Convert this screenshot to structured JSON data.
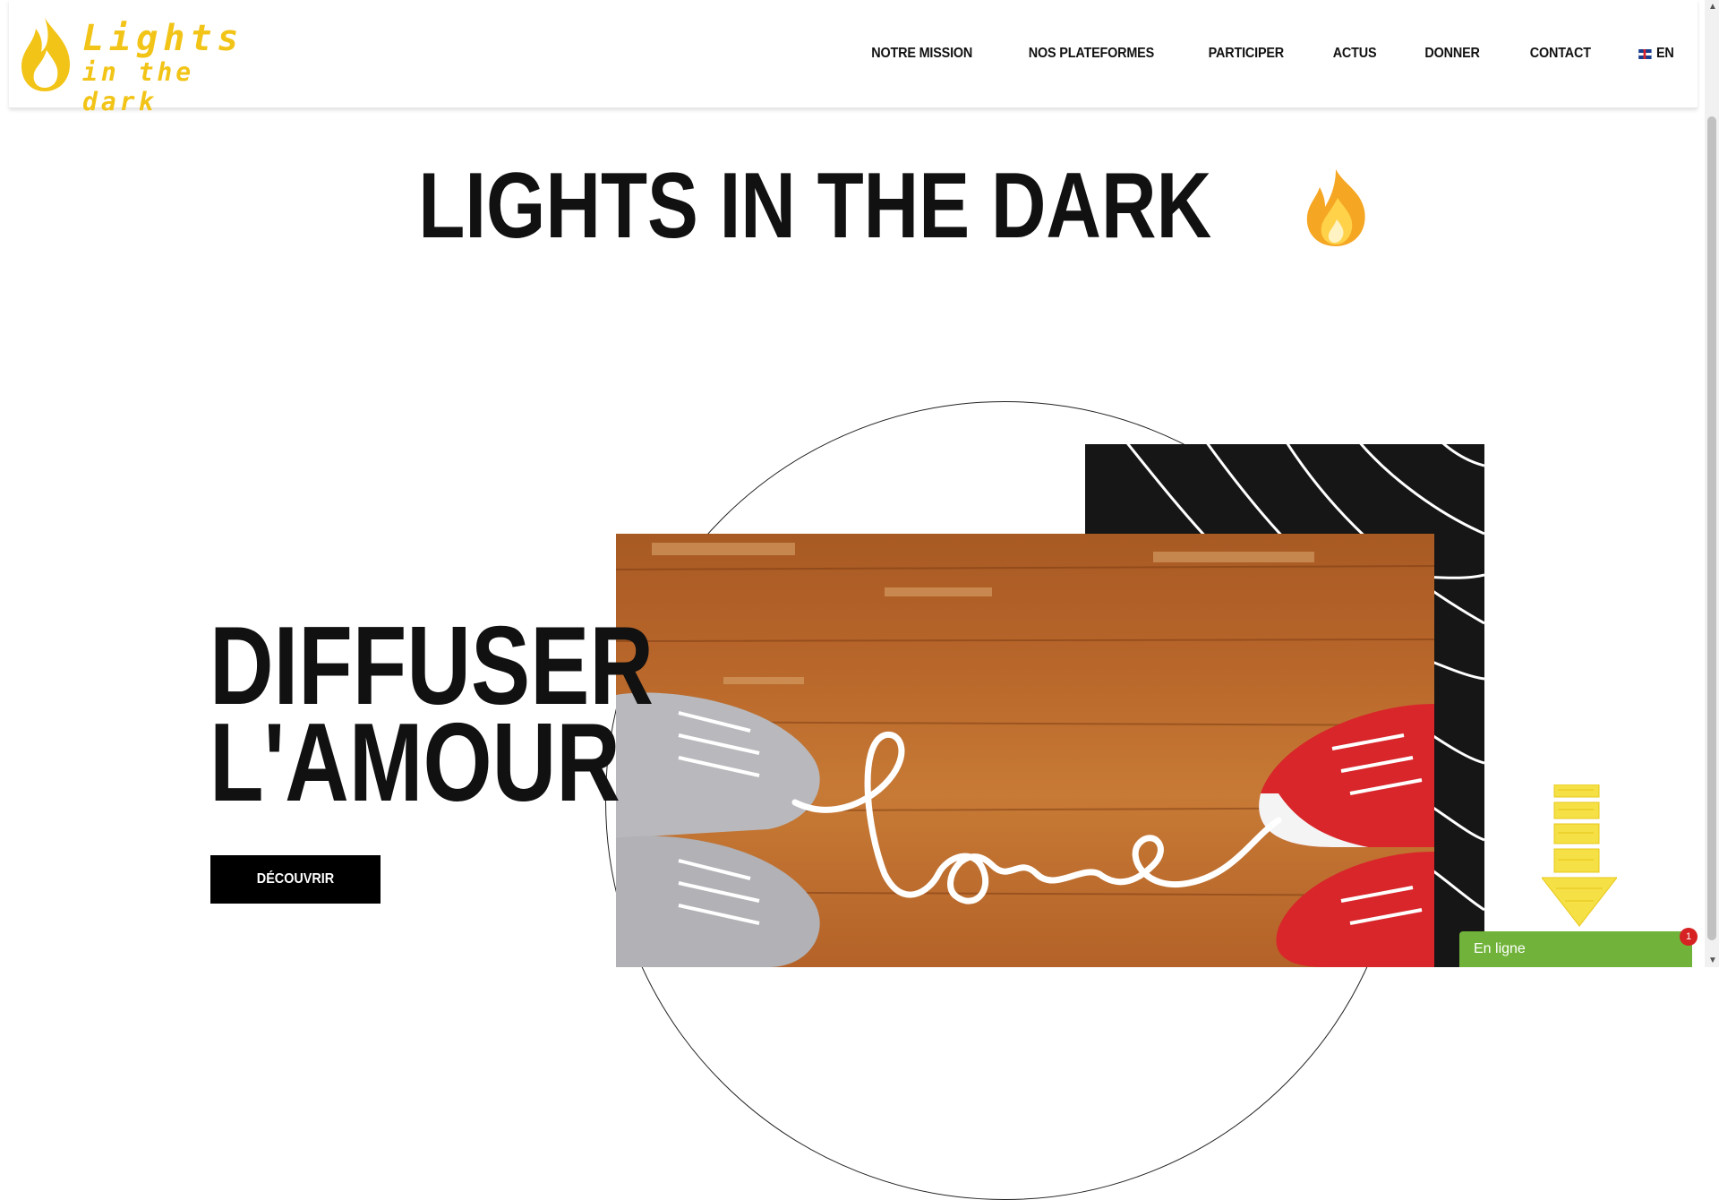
{
  "header": {
    "logo": {
      "line1": "Lights",
      "line2": "in the dark"
    },
    "nav": [
      {
        "label": "NOTRE MISSION"
      },
      {
        "label": "NOS PLATEFORMES"
      },
      {
        "label": "PARTICIPER"
      },
      {
        "label": "ACTUS"
      },
      {
        "label": "DONNER"
      },
      {
        "label": "CONTACT"
      }
    ],
    "language": {
      "label": "EN",
      "icon": "uk-flag-icon"
    }
  },
  "hero": {
    "title": "LIGHTS IN THE DARK",
    "title_icon": "fire-icon",
    "headline_line1": "DIFFUSER",
    "headline_line2": "L'AMOUR",
    "cta_label": "DÉCOUVRIR",
    "image_icon": "shoes-love-photo"
  },
  "chat": {
    "label": "En ligne",
    "badge": "1"
  },
  "colors": {
    "brand_yellow": "#f2c417",
    "dark_panel": "#161616",
    "chat_green": "#71b33a"
  }
}
